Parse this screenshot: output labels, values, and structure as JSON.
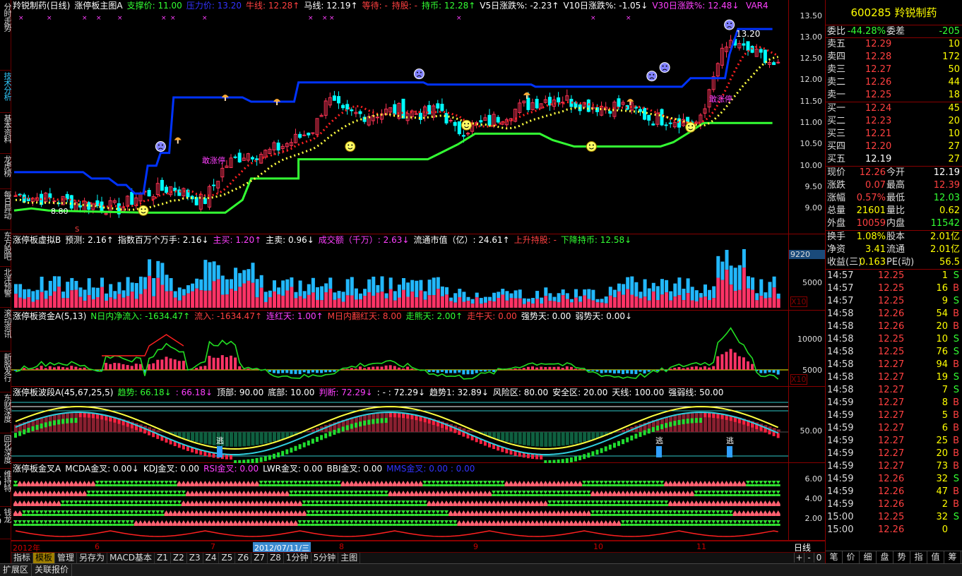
{
  "left_nav": [
    {
      "label": "分时走势",
      "active": false
    },
    {
      "label": "技术分析",
      "active": true
    },
    {
      "label": "基本资料",
      "active": false
    },
    {
      "label": "龙虎榜",
      "active": false
    },
    {
      "label": "每日异动",
      "active": false
    },
    {
      "label": "东方股吧",
      "active": false
    },
    {
      "label": "北洋预警",
      "active": false
    },
    {
      "label": "滚动资讯",
      "active": false
    },
    {
      "label": "新股发行",
      "active": false
    },
    {
      "label": "东财深度",
      "active": false
    },
    {
      "label": "回化深度",
      "active": false
    },
    {
      "label": "维持特10",
      "active": false
    },
    {
      "label": "钱龙10",
      "active": false
    }
  ],
  "main_panel": {
    "header": [
      {
        "text": "羚锐制药(日线)",
        "color": "#ffffff"
      },
      {
        "text": "涨停板主图A",
        "color": "#ffffff"
      },
      {
        "text": "支撑价: 11.00",
        "color": "#33ff33"
      },
      {
        "text": "压力价: 13.20",
        "color": "#3333ff"
      },
      {
        "text": "牛线: 12.28↑",
        "color": "#ff4040"
      },
      {
        "text": "马线: 12.19↑",
        "color": "#ffffff"
      },
      {
        "text": "等待: -",
        "color": "#ff4040"
      },
      {
        "text": "持股: -",
        "color": "#ff4040"
      },
      {
        "text": "持币: 12.28↑",
        "color": "#33ff33"
      },
      {
        "text": "V5日涨跌%: -2.23↑",
        "color": "#ffffff"
      },
      {
        "text": "V10日涨跌%: -1.05↓",
        "color": "#ffffff"
      },
      {
        "text": "V30日涨跌%: 12.48↓",
        "color": "#ff40ff"
      }
    ],
    "var_label": "VAR4",
    "y_ticks": [
      "13.50",
      "13.00",
      "12.50",
      "12.00",
      "11.50",
      "11.00",
      "10.50",
      "10.00",
      "9.50",
      "9.00"
    ],
    "annotations": {
      "high_label": "13.20",
      "low_label": "8.80",
      "text1": "敢涨停",
      "text2": "敢涨停",
      "marker_s": "S"
    }
  },
  "volume_panel": {
    "header": [
      {
        "text": "涨停板虚拟B",
        "color": "#ffffff"
      },
      {
        "text": "预测: 2.16↑",
        "color": "#ffffff"
      },
      {
        "text": "指数百万个万手: 2.16↓",
        "color": "#ffffff"
      },
      {
        "text": "主买: 1.20↑",
        "color": "#ff40ff"
      },
      {
        "text": "主卖: 0.96↓",
        "color": "#ffffff"
      },
      {
        "text": "成交额（千万）: 2.63↓",
        "color": "#ff40ff"
      },
      {
        "text": "流通市值（亿）: 24.61↑",
        "color": "#ffffff"
      },
      {
        "text": "上升持股: -",
        "color": "#ff4040"
      },
      {
        "text": "下降持币: 12.58↓",
        "color": "#33ff33"
      }
    ],
    "y_ticks": [
      "9220",
      "5000"
    ],
    "unit": "X10"
  },
  "fund_panel": {
    "header": [
      {
        "text": "涨停板资金A(5,13)",
        "color": "#ffffff"
      },
      {
        "text": "N日内净流入: -1634.47↑",
        "color": "#33ff33"
      },
      {
        "text": "流入: -1634.47↑",
        "color": "#ff4040"
      },
      {
        "text": "连红天: 1.00↑",
        "color": "#ff40ff"
      },
      {
        "text": "M日内翻红天: 8.00",
        "color": "#ff4040"
      },
      {
        "text": "走熊天: 2.00↑",
        "color": "#33ff33"
      },
      {
        "text": "走牛天: 0.00",
        "color": "#ff4040"
      },
      {
        "text": "强势天: 0.00",
        "color": "#ffffff"
      },
      {
        "text": "弱势天: 0.00↓",
        "color": "#ffffff"
      }
    ],
    "y_ticks": [
      "10000",
      "5000"
    ],
    "unit": "X10"
  },
  "wave_panel": {
    "header": [
      {
        "text": "涨停板波段A(45,67,25,5)",
        "color": "#ffffff"
      },
      {
        "text": "趋势: 66.18↓",
        "color": "#33ff33"
      },
      {
        "text": ": 66.18↓",
        "color": "#ff40ff"
      },
      {
        "text": "顶部: 90.00",
        "color": "#ffffff"
      },
      {
        "text": "底部: 10.00",
        "color": "#ffffff"
      },
      {
        "text": "判断: 72.29↓",
        "color": "#ff40ff"
      },
      {
        "text": ": - : 72.29↓",
        "color": "#ffffff"
      },
      {
        "text": "趋势1: 32.89↓",
        "color": "#ffffff"
      },
      {
        "text": "风险区: 80.00",
        "color": "#ffffff"
      },
      {
        "text": "安全区: 20.00",
        "color": "#ffffff"
      },
      {
        "text": "天线: 100.00",
        "color": "#ffffff"
      },
      {
        "text": "强弱线: 50.00",
        "color": "#ffffff"
      }
    ],
    "y_ticks": [
      "50.00"
    ],
    "escape_label": "逃"
  },
  "cross_panel": {
    "header": [
      {
        "text": "涨停板金叉A",
        "color": "#ffffff"
      },
      {
        "text": "MCDA金叉: 0.00↓",
        "color": "#ffffff"
      },
      {
        "text": "KDJ金叉: 0.00",
        "color": "#ffffff"
      },
      {
        "text": "RSI金叉: 0.00",
        "color": "#ff40ff"
      },
      {
        "text": "LWR金叉: 0.00",
        "color": "#ffffff"
      },
      {
        "text": "BBI金叉: 0.00",
        "color": "#ffffff"
      },
      {
        "text": "MMS金叉: 0.00 : 0.00",
        "color": "#3333ff"
      }
    ],
    "y_ticks": [
      "6.00",
      "4.00",
      "2.00"
    ]
  },
  "x_axis": {
    "labels": [
      {
        "text": "2012年",
        "highlight": false
      },
      {
        "text": "6",
        "highlight": false
      },
      {
        "text": "7",
        "highlight": false
      },
      {
        "text": "2012/07/11/三",
        "highlight": true
      },
      {
        "text": "8",
        "highlight": false
      },
      {
        "text": "9",
        "highlight": false
      },
      {
        "text": "10",
        "highlight": false
      },
      {
        "text": "11",
        "highlight": false
      }
    ],
    "period": "日线",
    "controls": [
      "+",
      "-",
      "0"
    ]
  },
  "bottom_tabs": [
    {
      "label": "指标",
      "active": false
    },
    {
      "label": "模板",
      "active": true
    },
    {
      "label": "管理",
      "active": false
    },
    {
      "label": "另存为",
      "active": false
    },
    {
      "label": "MACD基本",
      "active": false
    },
    {
      "label": "Z1",
      "active": false
    },
    {
      "label": "Z2",
      "active": false
    },
    {
      "label": "Z3",
      "active": false
    },
    {
      "label": "Z4",
      "active": false
    },
    {
      "label": "Z5",
      "active": false
    },
    {
      "label": "Z6",
      "active": false
    },
    {
      "label": "Z7",
      "active": false
    },
    {
      "label": "Z8",
      "active": false
    },
    {
      "label": "1分钟",
      "active": false
    },
    {
      "label": "5分钟",
      "active": false
    },
    {
      "label": "主图",
      "active": false
    }
  ],
  "status_bar": [
    "扩展区",
    "关联报价"
  ],
  "quote": {
    "code": "600285",
    "name": "羚锐制药",
    "weibi": {
      "label": "委比",
      "value": "-44.28%",
      "label2": "委差",
      "value2": "-205"
    },
    "asks": [
      {
        "label": "卖五",
        "price": "12.29",
        "vol": "10"
      },
      {
        "label": "卖四",
        "price": "12.28",
        "vol": "172"
      },
      {
        "label": "卖三",
        "price": "12.27",
        "vol": "50"
      },
      {
        "label": "卖二",
        "price": "12.26",
        "vol": "44"
      },
      {
        "label": "卖一",
        "price": "12.25",
        "vol": "18"
      }
    ],
    "bids": [
      {
        "label": "买一",
        "price": "12.24",
        "vol": "45"
      },
      {
        "label": "买二",
        "price": "12.23",
        "vol": "20"
      },
      {
        "label": "买三",
        "price": "12.21",
        "vol": "10"
      },
      {
        "label": "买四",
        "price": "12.20",
        "vol": "27"
      },
      {
        "label": "买五",
        "price": "12.19",
        "vol": "27"
      }
    ],
    "stats": [
      {
        "k": "现价",
        "v": "12.26",
        "vc": "red",
        "k2": "今开",
        "v2": "12.19",
        "v2c": "white"
      },
      {
        "k": "涨跌",
        "v": "0.07",
        "vc": "red",
        "k2": "最高",
        "v2": "12.39",
        "v2c": "red"
      },
      {
        "k": "涨幅",
        "v": "0.57%",
        "vc": "red",
        "k2": "最低",
        "v2": "12.03",
        "v2c": "green"
      },
      {
        "k": "总量",
        "v": "21601",
        "vc": "yellow",
        "k2": "量比",
        "v2": "0.62",
        "v2c": "yellow"
      },
      {
        "k": "外盘",
        "v": "10059",
        "vc": "red",
        "k2": "内盘",
        "v2": "11542",
        "v2c": "green"
      }
    ],
    "stats2": [
      {
        "k": "换手",
        "v": "1.08%",
        "vc": "yellow",
        "k2": "股本",
        "v2": "2.01亿",
        "v2c": "yellow"
      },
      {
        "k": "净资",
        "v": "3.41",
        "vc": "yellow",
        "k2": "流通",
        "v2": "2.01亿",
        "v2c": "yellow"
      },
      {
        "k": "收益(三)",
        "v": "0.163",
        "vc": "yellow",
        "k2": "PE(动)",
        "v2": "56.5",
        "v2c": "yellow"
      }
    ],
    "ticks": [
      {
        "t": "14:57",
        "p": "12.25",
        "pc": "red",
        "v": "1",
        "bs": "S"
      },
      {
        "t": "14:57",
        "p": "12.25",
        "pc": "red",
        "v": "16",
        "bs": "B"
      },
      {
        "t": "14:57",
        "p": "12.25",
        "pc": "red",
        "v": "9",
        "bs": "S"
      },
      {
        "t": "14:58",
        "p": "12.26",
        "pc": "red",
        "v": "54",
        "bs": "B"
      },
      {
        "t": "14:58",
        "p": "12.26",
        "pc": "red",
        "v": "20",
        "bs": "B"
      },
      {
        "t": "14:58",
        "p": "12.25",
        "pc": "red",
        "v": "10",
        "bs": "S"
      },
      {
        "t": "14:58",
        "p": "12.25",
        "pc": "red",
        "v": "76",
        "bs": "S"
      },
      {
        "t": "14:58",
        "p": "12.27",
        "pc": "red",
        "v": "94",
        "bs": "B"
      },
      {
        "t": "14:58",
        "p": "12.27",
        "pc": "red",
        "v": "19",
        "bs": "S"
      },
      {
        "t": "14:58",
        "p": "12.27",
        "pc": "red",
        "v": "7",
        "bs": "S"
      },
      {
        "t": "14:59",
        "p": "12.27",
        "pc": "red",
        "v": "8",
        "bs": "B"
      },
      {
        "t": "14:59",
        "p": "12.27",
        "pc": "red",
        "v": "5",
        "bs": "B"
      },
      {
        "t": "14:59",
        "p": "12.27",
        "pc": "red",
        "v": "6",
        "bs": "B"
      },
      {
        "t": "14:59",
        "p": "12.27",
        "pc": "red",
        "v": "25",
        "bs": "B"
      },
      {
        "t": "14:59",
        "p": "12.27",
        "pc": "red",
        "v": "20",
        "bs": "B"
      },
      {
        "t": "14:59",
        "p": "12.27",
        "pc": "red",
        "v": "73",
        "bs": "B"
      },
      {
        "t": "14:59",
        "p": "12.26",
        "pc": "red",
        "v": "32",
        "bs": "S"
      },
      {
        "t": "14:59",
        "p": "12.26",
        "pc": "red",
        "v": "47",
        "bs": "B"
      },
      {
        "t": "14:59",
        "p": "12.26",
        "pc": "red",
        "v": "2",
        "bs": "B"
      },
      {
        "t": "15:00",
        "p": "12.25",
        "pc": "red",
        "v": "32",
        "bs": "S"
      },
      {
        "t": "15:00",
        "p": "12.26",
        "pc": "red",
        "v": "0",
        "bs": ""
      }
    ],
    "bottom_tabs": [
      "笔",
      "价",
      "细",
      "盘",
      "势",
      "指",
      "值",
      "筹"
    ]
  },
  "colors": {
    "up": "#ff3355",
    "down": "#00ffff",
    "support": "#33ff33",
    "pressure": "#0033ff",
    "grid_border": "#800000"
  }
}
